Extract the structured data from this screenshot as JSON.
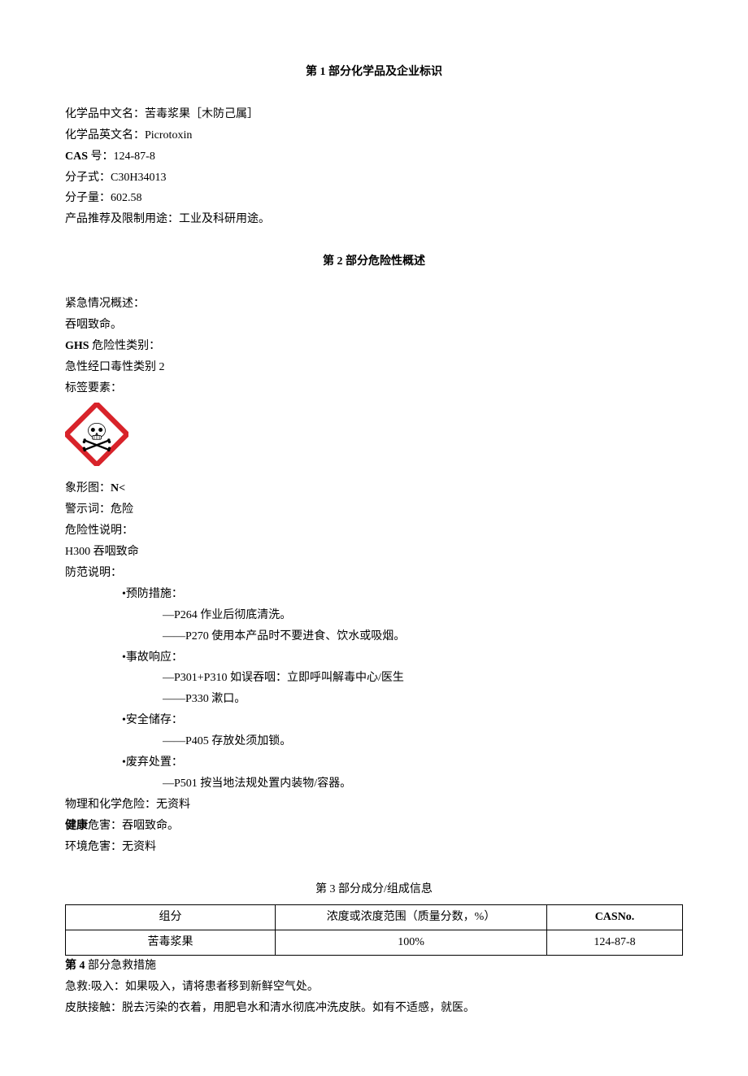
{
  "section1": {
    "title": "第 1 部分化学品及企业标识",
    "rows": [
      {
        "label": "化学品中文名：",
        "value": "苦毒浆果［木防己属］"
      },
      {
        "label": "化学品英文名：",
        "value": "Picrotoxin"
      },
      {
        "label_bold": "CAS",
        "label_rest": " 号：",
        "value": "124-87-8"
      },
      {
        "label": "分子式：",
        "value": "C30H34013"
      },
      {
        "label": "分子量：",
        "value": "602.58"
      },
      {
        "label": "产品推荐及限制用途：",
        "value": "工业及科研用途。"
      }
    ]
  },
  "section2": {
    "title": "第 2 部分危险性概述",
    "emergency_label": "紧急情况概述：",
    "emergency_text": "吞咽致命。",
    "ghs_label_bold": "GHS",
    "ghs_label_rest": " 危险性类别：",
    "ghs_class": "急性经口毒性类别 2",
    "label_elements": "标签要素：",
    "pictogram_label": "象形图：",
    "pictogram_value": "N<",
    "signal_label": "警示词：",
    "signal_value": "危险",
    "hazard_stmt_label": "危险性说明：",
    "hazard_h300": "H300 吞咽致命",
    "precaution_label": "防范说明：",
    "groups": [
      {
        "header": "•预防措施：",
        "items": [
          "—P264 作业后彻底清洗。",
          "——P270 使用本产品时不要进食、饮水或吸烟。"
        ]
      },
      {
        "header": "•事故响应：",
        "items": [
          "—P301+P310 如误吞咽：立即呼叫解毒中心/医生",
          "——P330 漱口。"
        ]
      },
      {
        "header": "•安全储存：",
        "items": [
          "——P405 存放处须加锁。"
        ]
      },
      {
        "header": "•废弃处置：",
        "items": [
          "—P501 按当地法规处置内装物/容器。"
        ]
      }
    ],
    "phys_label": "物理和化学危险：",
    "phys_value": "无资料",
    "health_label_bold": "健康",
    "health_label_rest": "危害：",
    "health_value": "吞咽致命。",
    "env_label": "环境危害：",
    "env_value": "无资料"
  },
  "section3": {
    "title": "第 3 部分成分/组成信息",
    "headers": [
      "组分",
      "浓度或浓度范围（质量分数，%）",
      "CASNo."
    ],
    "row": [
      "苦毒浆果",
      "100%",
      "124-87-8"
    ]
  },
  "section4": {
    "title_bold": "第 4 ",
    "title_rest": "部分急救措施",
    "inhale": "急救:吸入：如果吸入，请将患者移到新鲜空气处。",
    "skin": "皮肤接触：脱去污染的衣着，用肥皂水和清水彻底冲洗皮肤。如有不适感，就医。"
  }
}
